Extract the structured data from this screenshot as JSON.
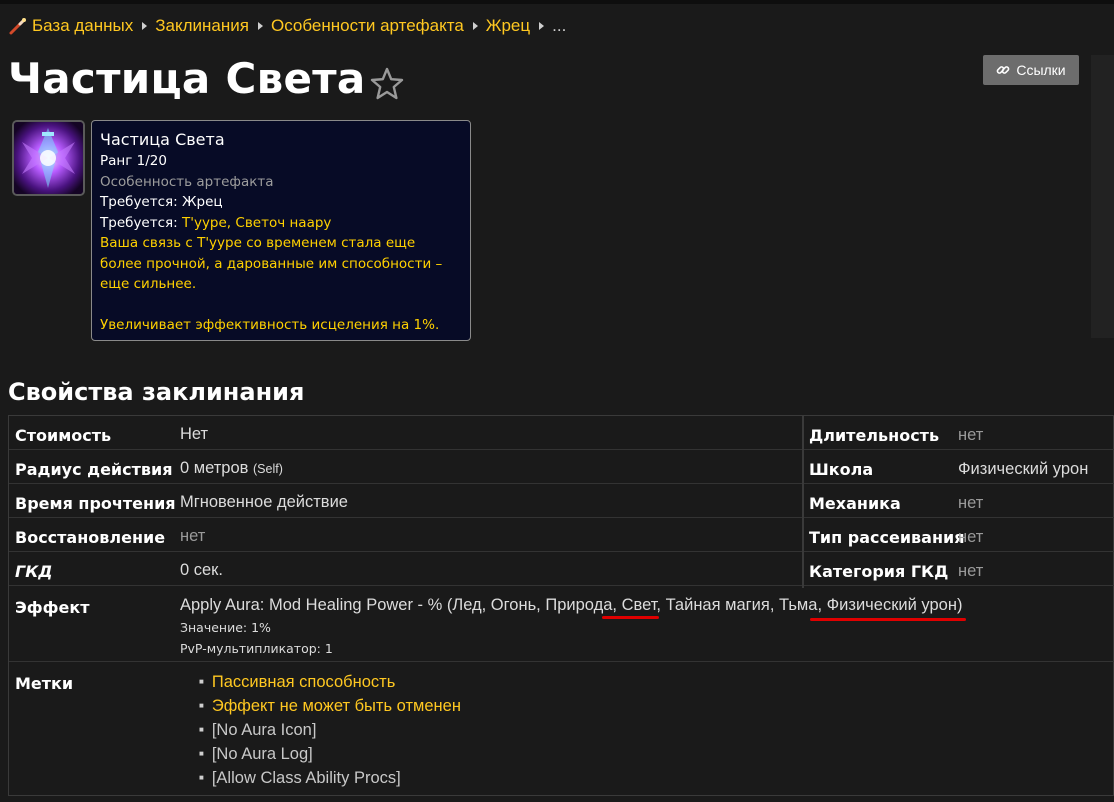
{
  "breadcrumb": {
    "items": [
      "База данных",
      "Заклинания",
      "Особенности артефакта",
      "Жрец"
    ],
    "more": "..."
  },
  "title": "Частица Света",
  "links_button": "Ссылки",
  "tooltip": {
    "name": "Частица Света",
    "rank": "Ранг 1/20",
    "type": "Особенность артефакта",
    "req1": "Требуется: Жрец",
    "req2_label": "Требуется: ",
    "req2_value": "Т'ууре, Светоч наару",
    "desc_lines": [
      "Ваша связь с Т'ууре со временем стала еще",
      "более прочной, а дарованные им способности –",
      "еще сильнее."
    ],
    "effect": "Увеличивает эффективность исцеления на 1%."
  },
  "section_title": "Свойства заклинания",
  "props": {
    "cost_label": "Стоимость",
    "cost_value": "Нет",
    "range_label": "Радиус действия",
    "range_value": "0 метров",
    "range_note": "(Self)",
    "cast_label": "Время прочтения",
    "cast_value": "Мгновенное действие",
    "cooldown_label": "Восстановление",
    "cooldown_value": "нет",
    "gcd_label": "ГКД",
    "gcd_value": "0 сек.",
    "duration_label": "Длительность",
    "duration_value": "нет",
    "school_label": "Школа",
    "school_value": "Физический урон",
    "mechanic_label": "Механика",
    "mechanic_value": "нет",
    "dispel_label": "Тип рассеивания",
    "dispel_value": "нет",
    "gcdcat_label": "Категория ГКД",
    "gcdcat_value": "нет",
    "effect_label": "Эффект",
    "effect_value": "Apply Aura: Mod Healing Power - % (Лед, Огонь, Природа, Свет, Тайная магия, Тьма, Физический урон)",
    "effect_amount": "Значение: 1%",
    "effect_pvp": "PvP-мультипликатор: 1",
    "flags_label": "Метки",
    "flags": [
      "Пассивная способность",
      "Эффект не может быть отменен",
      "[No Aura Icon]",
      "[No Aura Log]",
      "[Allow Class Ability Procs]"
    ]
  },
  "colors": {
    "gold": "#ffc821",
    "tooltip_bg": "#070b26",
    "underline": "#e00000"
  }
}
